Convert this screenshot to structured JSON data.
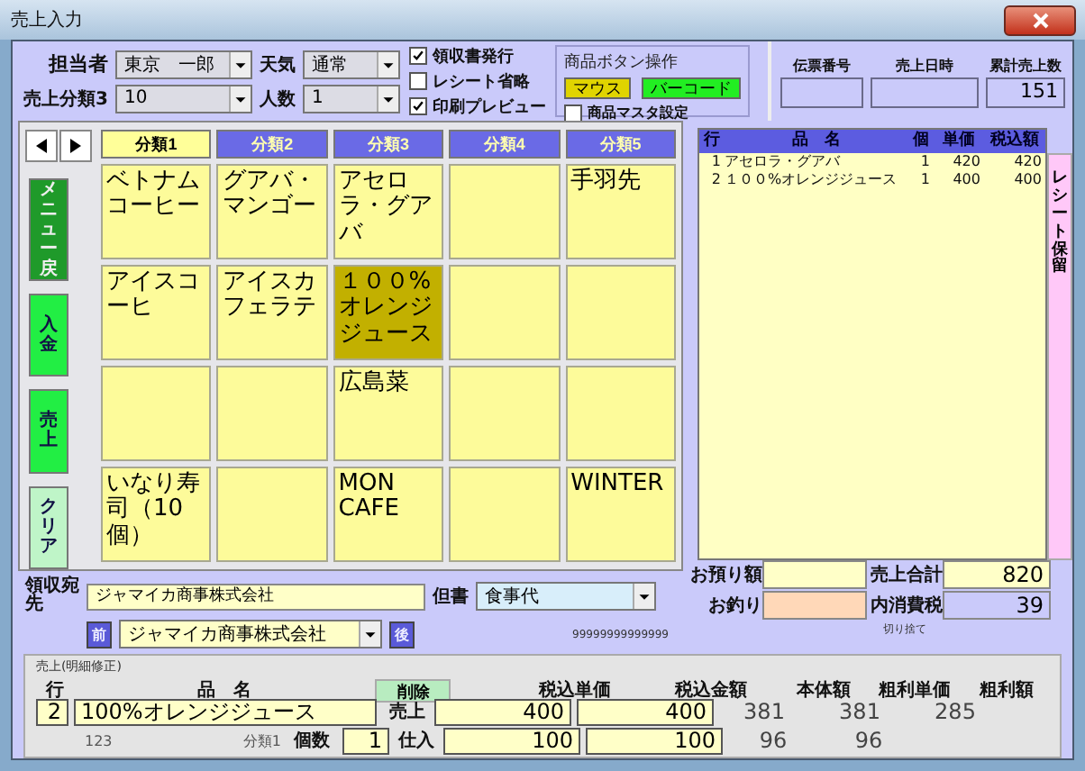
{
  "window": {
    "title": "売上入力"
  },
  "header": {
    "staff": {
      "label": "担当者",
      "value": "東京　一郎"
    },
    "category3": {
      "label": "売上分類3",
      "value": "10"
    },
    "weather": {
      "label": "天気",
      "value": "通常"
    },
    "people": {
      "label": "人数",
      "value": "1"
    },
    "options": [
      {
        "label": "領収書発行",
        "checked": true
      },
      {
        "label": "レシート省略",
        "checked": false
      },
      {
        "label": "印刷プレビュー",
        "checked": true
      }
    ],
    "button_mode": {
      "title": "商品ボタン操作",
      "modes": [
        {
          "label": "マウス",
          "color": "#e0d400"
        },
        {
          "label": "バーコード",
          "color": "#22ee22"
        }
      ],
      "master": {
        "label": "商品マスタ設定",
        "checked": false
      }
    },
    "info": [
      {
        "label": "伝票番号"
      },
      {
        "label": "売上日時"
      },
      {
        "label": "累計売上数",
        "value": "151"
      }
    ]
  },
  "side_buttons": [
    {
      "label": "メニュー戻",
      "color": "#1f9a2a"
    },
    {
      "label": "入金",
      "color": "#22ee44"
    },
    {
      "label": "売上",
      "color": "#22ee44"
    },
    {
      "label": "クリア",
      "color": "#bff5c8"
    }
  ],
  "category_tabs": [
    {
      "label": "分類1",
      "selected": true
    },
    {
      "label": "分類2",
      "selected": false
    },
    {
      "label": "分類3",
      "selected": false
    },
    {
      "label": "分類4",
      "selected": false
    },
    {
      "label": "分類5",
      "selected": false
    }
  ],
  "product_grid": [
    [
      {
        "label": "ベトナムコーヒー",
        "selected": false
      },
      {
        "label": "グアバ・マンゴー",
        "selected": false
      },
      {
        "label": "アセロラ・グアバ",
        "selected": false
      },
      {
        "selected": false
      },
      {
        "label": "手羽先",
        "selected": false
      }
    ],
    [
      {
        "label": "アイスコーヒ",
        "selected": false
      },
      {
        "label": "アイスカフェラテ",
        "selected": false
      },
      {
        "label": "１００%オレンジジュース",
        "selected": true
      },
      {
        "selected": false
      },
      {
        "selected": false
      }
    ],
    [
      {
        "selected": false
      },
      {
        "selected": false
      },
      {
        "label": "広島菜",
        "selected": false
      },
      {
        "selected": false
      },
      {
        "selected": false
      }
    ],
    [
      {
        "label": "いなり寿司（10個）",
        "selected": false
      },
      {
        "selected": false
      },
      {
        "label": "MON CAFE",
        "selected": false
      },
      {
        "selected": false
      },
      {
        "label": "WINTER",
        "selected": false
      }
    ]
  ],
  "receipt": {
    "columns": [
      "行",
      "品　名",
      "個",
      "単価",
      "税込額"
    ],
    "rows": [
      [
        "1",
        "アセロラ・グアバ",
        "1",
        "420",
        "420"
      ],
      [
        "2",
        "１００%オレンジジュース",
        "1",
        "400",
        "400"
      ]
    ],
    "hold_button": "レシート保留"
  },
  "payment": {
    "deposit_label": "お預り額",
    "change_label": "お釣り",
    "total": {
      "label": "売上合計",
      "value": "820"
    },
    "tax": {
      "label": "内消費税",
      "value": "39",
      "note": "切り捨て"
    }
  },
  "receipt_address": {
    "label": "領収宛先",
    "value": "ジャマイカ商事株式会社",
    "prev": "前",
    "next": "後",
    "select_value": "ジャマイカ商事株式会社",
    "memo_label": "但書",
    "memo_value": "食事代",
    "code": "99999999999999"
  },
  "detail": {
    "title": "売上(明細修正)",
    "row_label": "行",
    "row_value": "2",
    "name_label": "品　名",
    "name_value": "100%オレンジジュース",
    "delete": "削除",
    "code": "123",
    "category": "分類1",
    "qty_label": "個数",
    "qty_value": "1",
    "sales_label": "売上",
    "purchase_label": "仕入",
    "columns": [
      {
        "label": "税込単価",
        "sales": "400",
        "purchase": "100",
        "kind": "input"
      },
      {
        "label": "税込金額",
        "sales": "400",
        "purchase": "100",
        "kind": "input"
      },
      {
        "label": "本体額",
        "sales": "381",
        "purchase": "96",
        "kind": "text"
      },
      {
        "label": "粗利単価",
        "sales": "381",
        "purchase": "96",
        "kind": "text"
      },
      {
        "label": "粗利額",
        "sales": "285",
        "kind": "text"
      }
    ]
  }
}
